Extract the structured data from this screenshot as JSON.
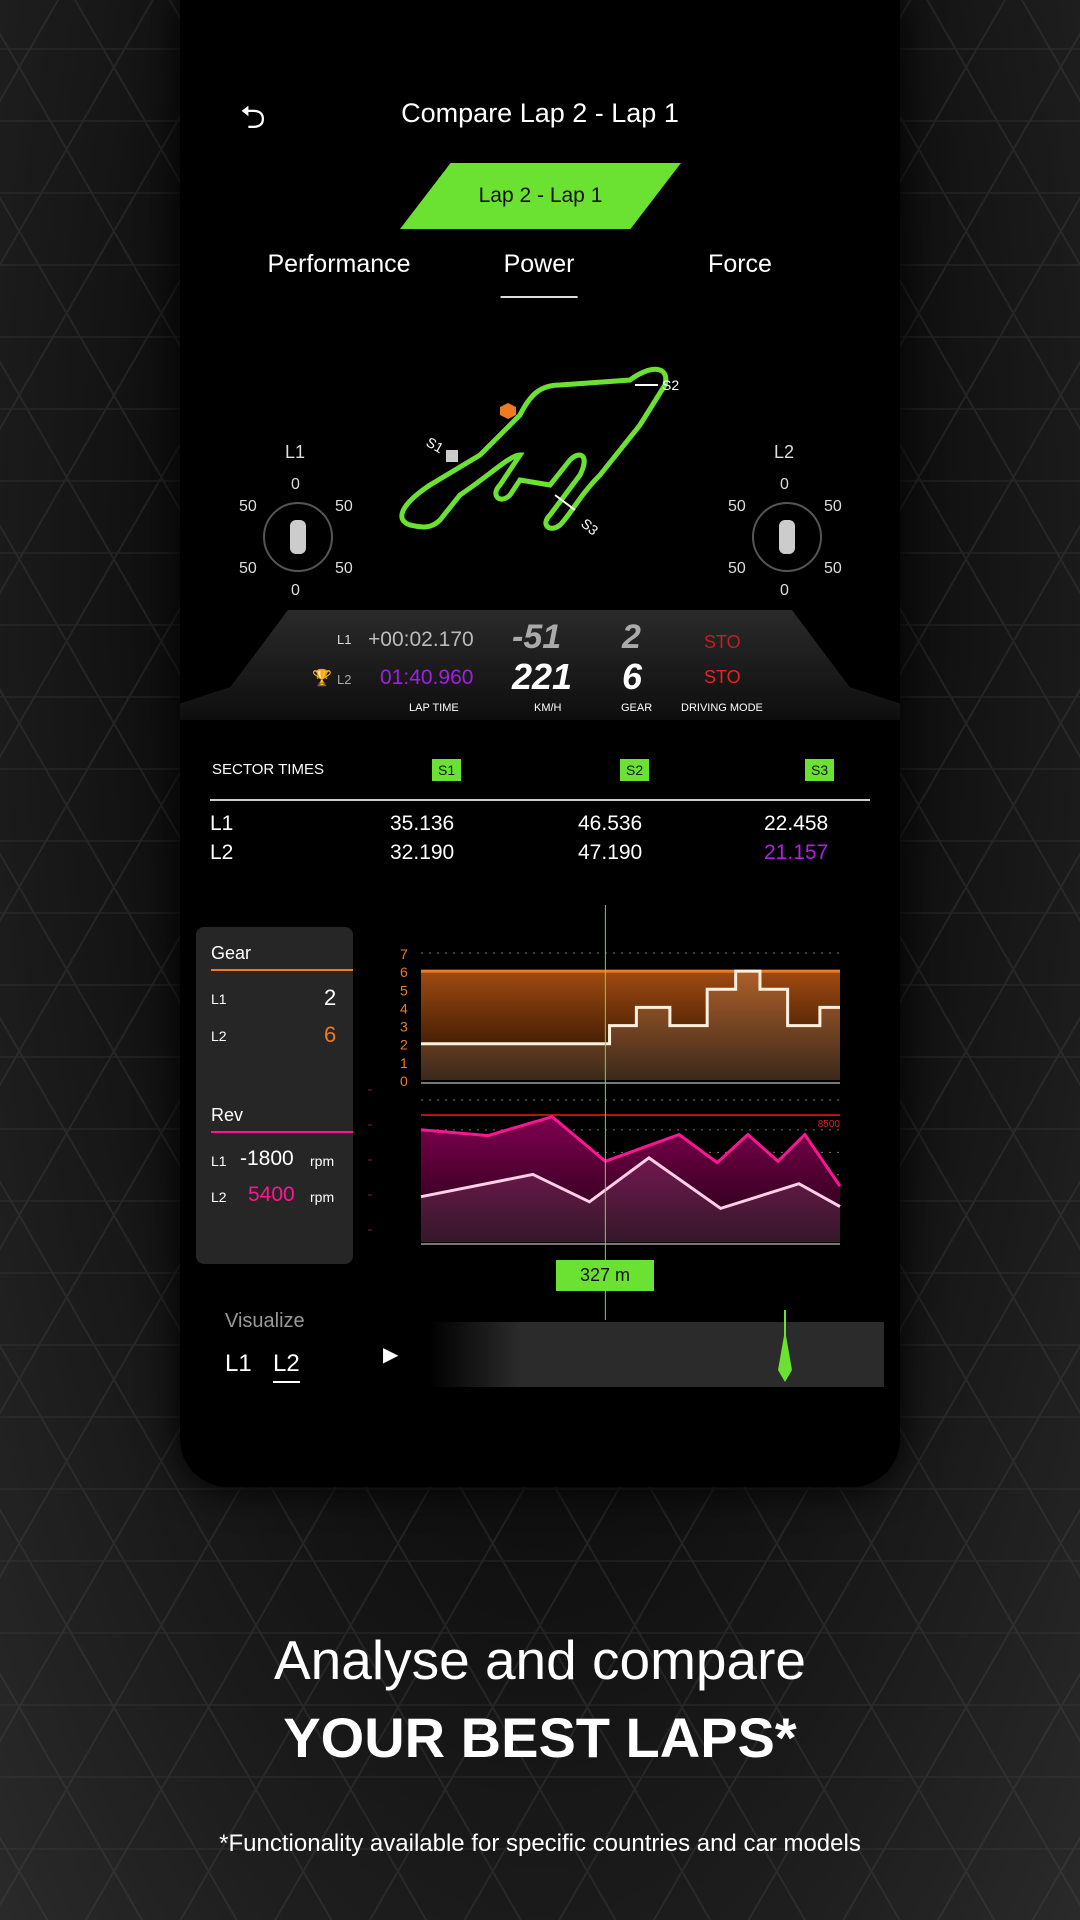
{
  "header": {
    "title": "Compare Lap 2 - Lap 1",
    "back_icon": "back-arrow-icon"
  },
  "lap_selector": {
    "label": "Lap 2 - Lap 1",
    "color": "#6be231"
  },
  "tabs": [
    {
      "label": "Performance"
    },
    {
      "label": "Power",
      "active": true
    },
    {
      "label": "Force"
    }
  ],
  "track": {
    "sector_labels": [
      "S1",
      "S2",
      "S3"
    ],
    "color": "#6be231",
    "marker_color": "#f07a20"
  },
  "gauges": {
    "l1": {
      "label": "L1",
      "top": "0",
      "bottom": "0",
      "left_top": "50",
      "right_top": "50",
      "left_bottom": "50",
      "right_bottom": "50"
    },
    "l2": {
      "label": "L2",
      "top": "0",
      "bottom": "0",
      "left_top": "50",
      "right_top": "50",
      "left_bottom": "50",
      "right_bottom": "50"
    }
  },
  "dashboard": {
    "rows": [
      {
        "lap": "L1",
        "time": "+00:02.170",
        "speed": "-51",
        "gear": "2",
        "mode": "STO"
      },
      {
        "lap": "L2",
        "time": "01:40.960",
        "speed": "221",
        "gear": "6",
        "mode": "STO",
        "best": true
      }
    ],
    "labels": {
      "time": "LAP TIME",
      "speed": "KM/H",
      "gear": "GEAR",
      "mode": "DRIVING MODE"
    }
  },
  "sectors": {
    "header": "SECTOR TIMES",
    "columns": [
      "S1",
      "S2",
      "S3"
    ],
    "rows": [
      {
        "lap": "L1",
        "times": [
          "35.136",
          "46.536",
          "22.458"
        ]
      },
      {
        "lap": "L2",
        "times": [
          "32.190",
          "47.190",
          "21.157"
        ]
      }
    ],
    "best_color": "#b020e0"
  },
  "panel": {
    "gear": {
      "title": "Gear",
      "l1_label": "L1",
      "l1": "2",
      "l2_label": "L2",
      "l2": "6",
      "color": "#f07a20"
    },
    "rev": {
      "title": "Rev",
      "l1_label": "L1",
      "l1": "-1800",
      "l2_label": "L2",
      "l2": "5400",
      "unit": "rpm",
      "color": "#ff1493"
    }
  },
  "chart_data": [
    {
      "type": "line",
      "title": "Gear",
      "y_ticks": [
        "0",
        "1",
        "2",
        "3",
        "4",
        "5",
        "6",
        "7"
      ],
      "ylim": [
        0,
        7
      ],
      "xlim": [
        0,
        100
      ],
      "series": [
        {
          "name": "L2",
          "step": true,
          "x": [
            0,
            100
          ],
          "y": [
            6,
            6
          ],
          "color": "#f07a20"
        },
        {
          "name": "L1",
          "step": true,
          "x": [
            0,
            45,
            51.4,
            59.4,
            68.3,
            75.1,
            80.9,
            87.5,
            95.2,
            100
          ],
          "y": [
            2,
            3,
            4,
            3,
            5,
            6,
            5,
            3,
            4,
            4
          ],
          "color": "#fff0e0"
        }
      ]
    },
    {
      "type": "area",
      "title": "Rev",
      "ylim": [
        0,
        9500
      ],
      "xlim": [
        0,
        100
      ],
      "reference": {
        "value": 8500,
        "label": "8500",
        "color": "#e02020"
      },
      "series": [
        {
          "name": "L2",
          "x": [
            0,
            16,
            31.3,
            44,
            61.6,
            70.7,
            78,
            85.2,
            91.6,
            100
          ],
          "y": [
            7510,
            7120,
            8380,
            5400,
            7190,
            5310,
            7190,
            5400,
            7190,
            3740
          ],
          "color": "#ff1493"
        },
        {
          "name": "L1",
          "x": [
            0,
            26.7,
            40.2,
            54.4,
            71.5,
            90.2,
            100
          ],
          "y": [
            3030,
            4520,
            2690,
            5630,
            2250,
            3900,
            2370
          ],
          "color": "#ffd0e8"
        }
      ]
    }
  ],
  "cursor": {
    "position_pct": 44,
    "label": "327 m"
  },
  "visualize": {
    "title": "Visualize",
    "options": [
      "L1",
      "L2"
    ],
    "selected": "L2",
    "play_icon": "play-icon"
  },
  "promo": {
    "line1": "Analyse and compare",
    "line2": "YOUR BEST LAPS*",
    "footnote": "*Functionality available for specific countries and car models"
  }
}
